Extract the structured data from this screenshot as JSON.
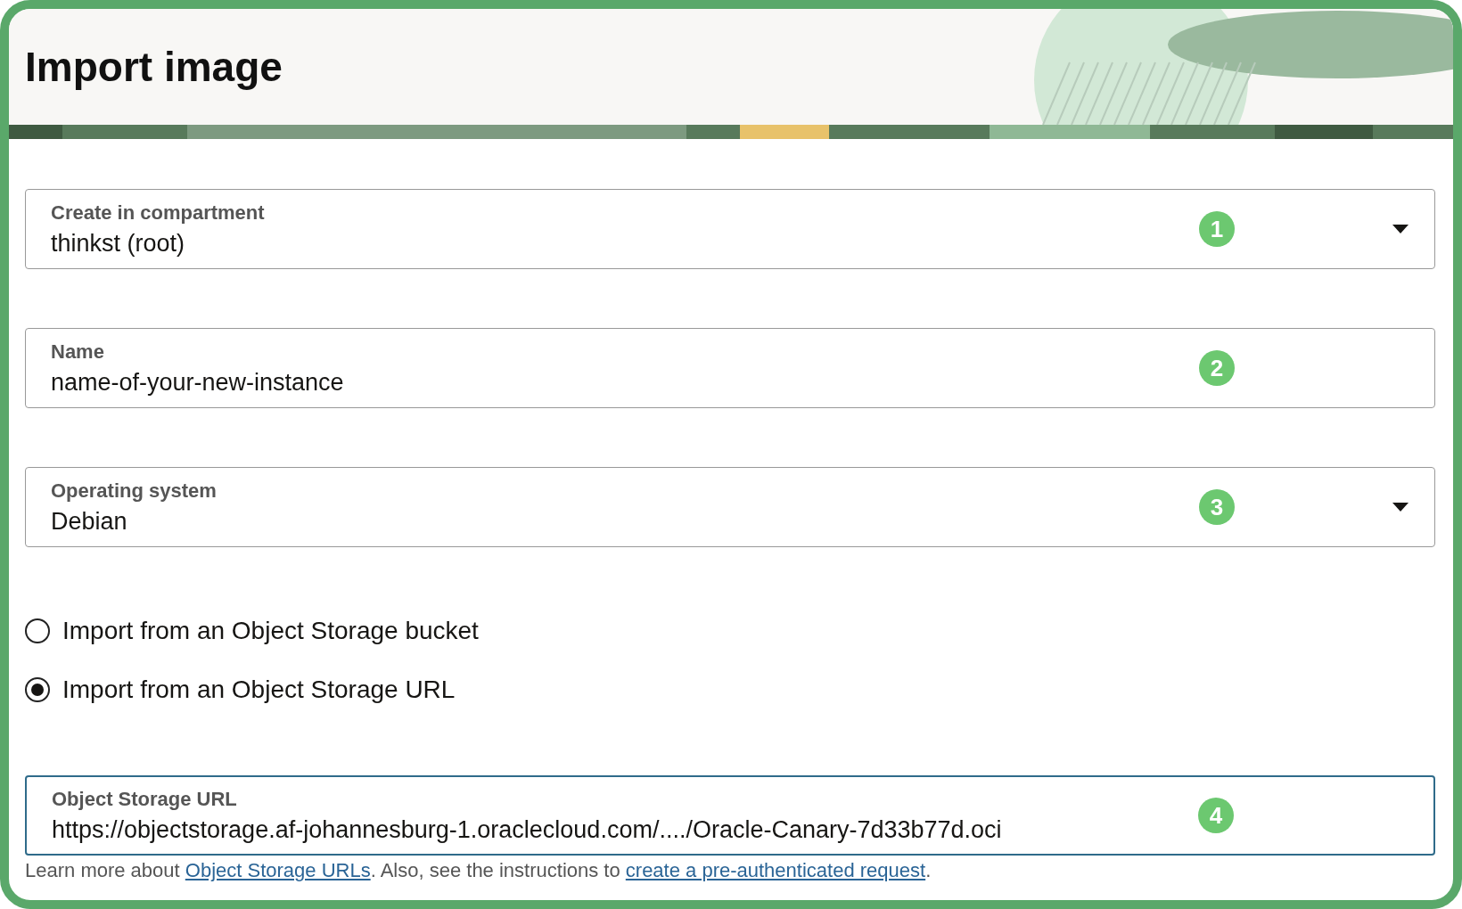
{
  "header": {
    "title": "Import image"
  },
  "fields": [
    {
      "kind": "select",
      "label": "Create in compartment",
      "value": "thinkst (root)",
      "badge": "1",
      "focused": false
    },
    {
      "kind": "text",
      "label": "Name",
      "value": "name-of-your-new-instance",
      "badge": "2",
      "focused": false
    },
    {
      "kind": "select",
      "label": "Operating system",
      "value": "Debian",
      "badge": "3",
      "focused": false
    }
  ],
  "import_source": [
    {
      "label": "Import from an Object Storage bucket",
      "selected": false
    },
    {
      "label": "Import from an Object Storage URL",
      "selected": true
    }
  ],
  "url_field": {
    "label": "Object Storage URL",
    "value": "https://objectstorage.af-johannesburg-1.oraclecloud.com/..../Oracle-Canary-7d33b77d.oci",
    "badge": "4",
    "focused": true
  },
  "help": [
    {
      "kind": "text",
      "text": "Learn more about "
    },
    {
      "kind": "link",
      "text": "Object Storage URLs"
    },
    {
      "kind": "text",
      "text": ". Also, see the instructions to "
    },
    {
      "kind": "link",
      "text": "create a pre-authenticated request"
    },
    {
      "kind": "text",
      "text": "."
    }
  ]
}
